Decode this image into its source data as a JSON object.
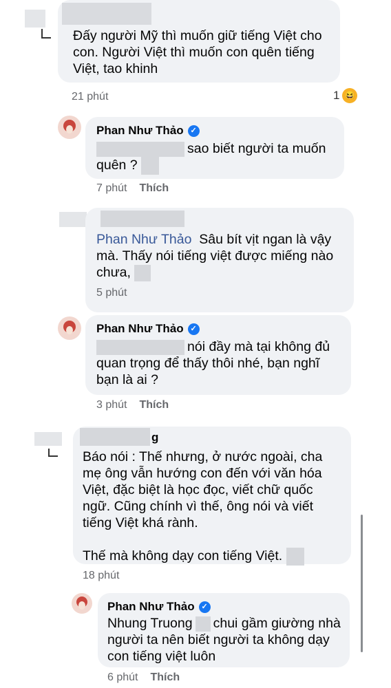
{
  "c1": {
    "text": "Đấy người Mỹ thì muốn giữ tiếng Việt cho con. Người Việt thì muốn con quên tiếng Việt, tao khinh",
    "time": "21 phút",
    "reaction_count": "1"
  },
  "r1": {
    "name": "Phan Như Thảo",
    "text_a": "sao biết người ta muốn",
    "text_b": "quên ?",
    "time": "7 phút",
    "like": "Thích"
  },
  "c2": {
    "mention": "Phan Như Thảo",
    "text_a": "Sâu bít vịt ngan là vậy",
    "text_b": "mà. Thấy nói tiếng việt được miếng nào",
    "text_c": "chưa,",
    "time": "5 phút"
  },
  "r2": {
    "name": "Phan Như Thảo",
    "text_a": "nói đầy mà tại không đủ",
    "text_b": "quan trọng để thấy thôi nhé, bạn nghĩ",
    "text_c": "bạn là ai ?",
    "time": "3 phút",
    "like": "Thích"
  },
  "c3": {
    "name_tail": "g",
    "text": "Báo nói : Thế nhưng, ở nước ngoài, cha mẹ ông vẫn hướng con đến với văn hóa Việt, đặc biệt là học đọc, viết chữ quốc ngữ. Cũng chính vì thế, ông nói và viết tiếng Việt khá rành.",
    "text2": "Thế mà không dạy con tiếng Việt.",
    "time": "18 phút"
  },
  "r3": {
    "name": "Phan Như Thảo",
    "mention": "Nhung Truong",
    "text_a": "chui gầm giường nhà",
    "text_b": "người ta nên biết người ta không dạy",
    "text_c": "con tiếng việt luôn",
    "time": "6 phút",
    "like": "Thích"
  }
}
